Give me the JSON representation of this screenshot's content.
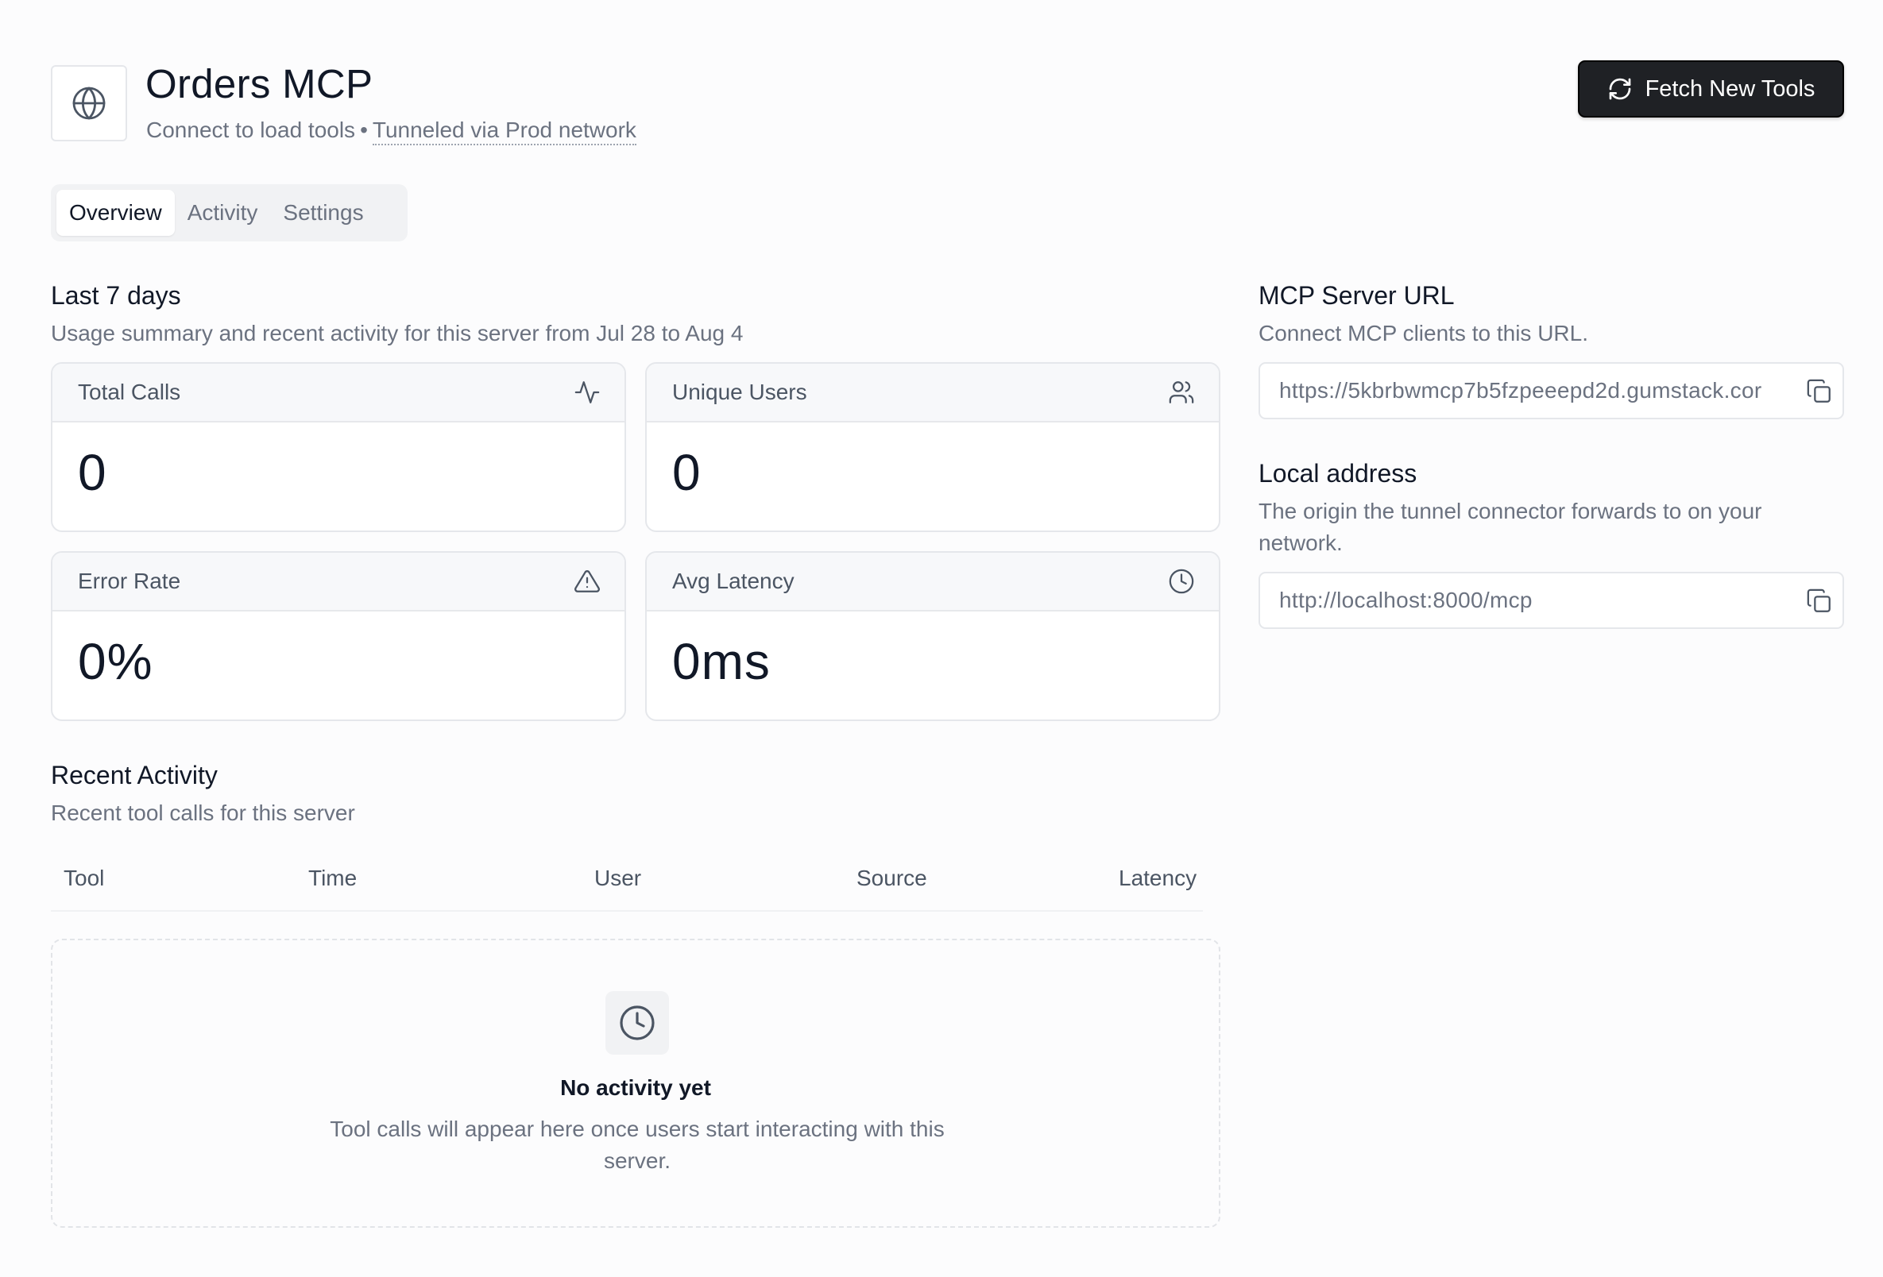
{
  "header": {
    "title": "Orders MCP",
    "status_text": "Connect to load tools",
    "separator": "•",
    "network_link": "Tunneled via Prod network",
    "fetch_button_label": "Fetch New Tools"
  },
  "tabs": [
    {
      "label": "Overview",
      "active": true
    },
    {
      "label": "Activity",
      "active": false
    },
    {
      "label": "Settings",
      "active": false
    }
  ],
  "summary": {
    "title": "Last 7 days",
    "description": "Usage summary and recent activity for this server from Jul 28 to Aug 4",
    "cards": [
      {
        "label": "Total Calls",
        "value": "0",
        "icon": "activity-icon"
      },
      {
        "label": "Unique Users",
        "value": "0",
        "icon": "users-icon"
      },
      {
        "label": "Error Rate",
        "value": "0%",
        "icon": "warning-icon"
      },
      {
        "label": "Avg Latency",
        "value": "0ms",
        "icon": "clock-icon"
      }
    ]
  },
  "recent_activity": {
    "title": "Recent Activity",
    "description": "Recent tool calls for this server",
    "columns": [
      "Tool",
      "Time",
      "User",
      "Source",
      "Latency"
    ],
    "empty_title": "No activity yet",
    "empty_description": "Tool calls will appear here once users start interacting with this server."
  },
  "server_url": {
    "title": "MCP Server URL",
    "description": "Connect MCP clients to this URL.",
    "value": "https://5kbrbwmcp7b5fzpeeepd2d.gumstack.cor"
  },
  "local_address": {
    "title": "Local address",
    "description": "The origin the tunnel connector forwards to on your network.",
    "value": "http://localhost:8000/mcp"
  },
  "colors": {
    "primary_button": "#1f2125",
    "muted_text": "#6b7280",
    "border": "#e5e7eb"
  }
}
